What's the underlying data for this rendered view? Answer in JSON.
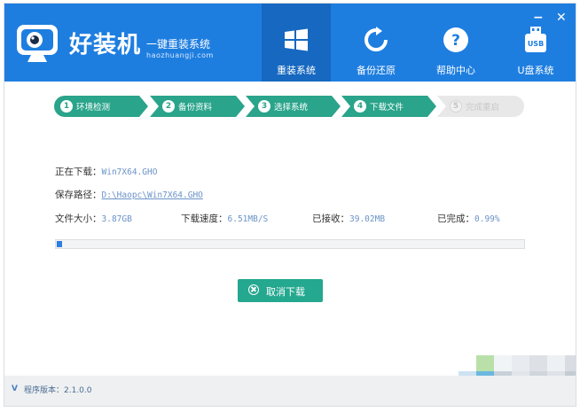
{
  "app": {
    "brand": "好装机",
    "slogan": "一键重装系统",
    "url": "haozhuangji.com"
  },
  "window_controls": {
    "minimize": "−",
    "close": "✕"
  },
  "nav": [
    {
      "label": "重装系统",
      "icon": "windows-icon",
      "active": true
    },
    {
      "label": "备份还原",
      "icon": "refresh-icon",
      "active": false
    },
    {
      "label": "帮助中心",
      "icon": "help-icon",
      "active": false
    },
    {
      "label": "U盘系统",
      "icon": "usb-icon",
      "active": false
    }
  ],
  "usb_icon_text": "USB",
  "steps": [
    {
      "num": "1",
      "label": "环境检测",
      "done": true
    },
    {
      "num": "2",
      "label": "备份资料",
      "done": true
    },
    {
      "num": "3",
      "label": "选择系统",
      "done": true
    },
    {
      "num": "4",
      "label": "下载文件",
      "done": true
    },
    {
      "num": "5",
      "label": "完成重启",
      "done": false
    }
  ],
  "download": {
    "downloading_label": "正在下载：",
    "downloading_value": "Win7X64.GHO",
    "path_label": "保存路径：",
    "path_value": "D:\\Haopc\\Win7X64.GHO",
    "size_label": "文件大小：",
    "size_value": "3.87GB",
    "speed_label": "下载速度：",
    "speed_value": "6.51MB/S",
    "received_label": "已接收：",
    "received_value": "39.02MB",
    "completed_label": "已完成：",
    "completed_value": "0.99%",
    "progress_fraction": 0.0099
  },
  "cancel_button": "取消下载",
  "footer": {
    "version_icon": "V",
    "version_label": "程序版本：2.1.0.0"
  },
  "colors": {
    "header": "#1e7ee0",
    "step_active": "#2aa48b",
    "step_pending": "#e6e6e6",
    "button": "#24a88f",
    "progress": "#2f7fe0"
  }
}
